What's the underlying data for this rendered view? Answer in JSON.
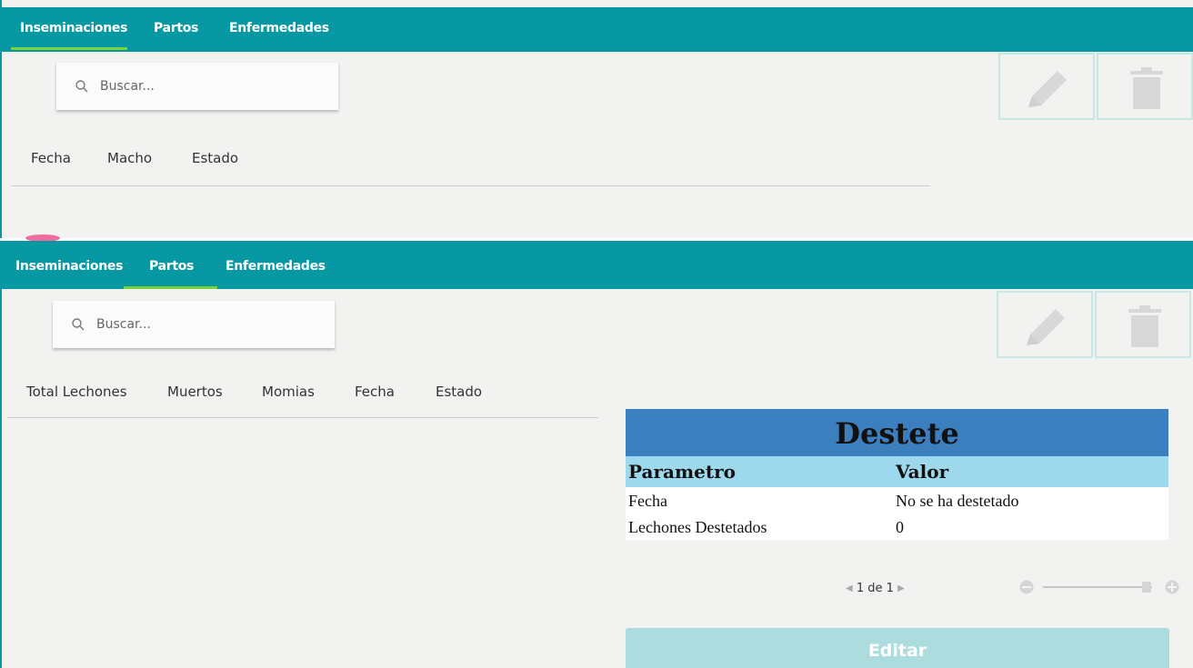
{
  "top": {
    "tabs": [
      {
        "label": "Inseminaciones"
      },
      {
        "label": "Partos"
      },
      {
        "label": "Enfermedades"
      }
    ],
    "active_tab": "Inseminaciones",
    "search": {
      "placeholder": "Buscar..."
    },
    "columns": [
      "Fecha",
      "Macho",
      "Estado"
    ],
    "toolbar": {
      "edit_icon": "pencil-icon",
      "delete_icon": "trash-icon"
    }
  },
  "bottom": {
    "tabs": [
      {
        "label": "Inseminaciones"
      },
      {
        "label": "Partos"
      },
      {
        "label": "Enfermedades"
      }
    ],
    "active_tab": "Partos",
    "search": {
      "placeholder": "Buscar..."
    },
    "columns": [
      "Total Lechones",
      "Muertos",
      "Momias",
      "Fecha",
      "Estado"
    ],
    "toolbar": {
      "edit_icon": "pencil-icon",
      "delete_icon": "trash-icon"
    },
    "destete": {
      "title": "Destete",
      "headers": [
        "Parametro",
        "Valor"
      ],
      "rows": [
        [
          "Fecha",
          "No se ha destetado"
        ],
        [
          "Lechones Destetados",
          "0"
        ]
      ]
    },
    "pager": {
      "current": "1",
      "of_label": "de",
      "total": "1"
    },
    "zoom": {
      "level": 0.95
    },
    "edit_button": "Editar"
  },
  "colors": {
    "topbar": "#0799a3",
    "active_underline": "#7bd23a",
    "destete_title_bg": "#3c7fbf",
    "destete_header_bg": "#9ed8ec",
    "edit_button_bg": "#acdcde"
  }
}
